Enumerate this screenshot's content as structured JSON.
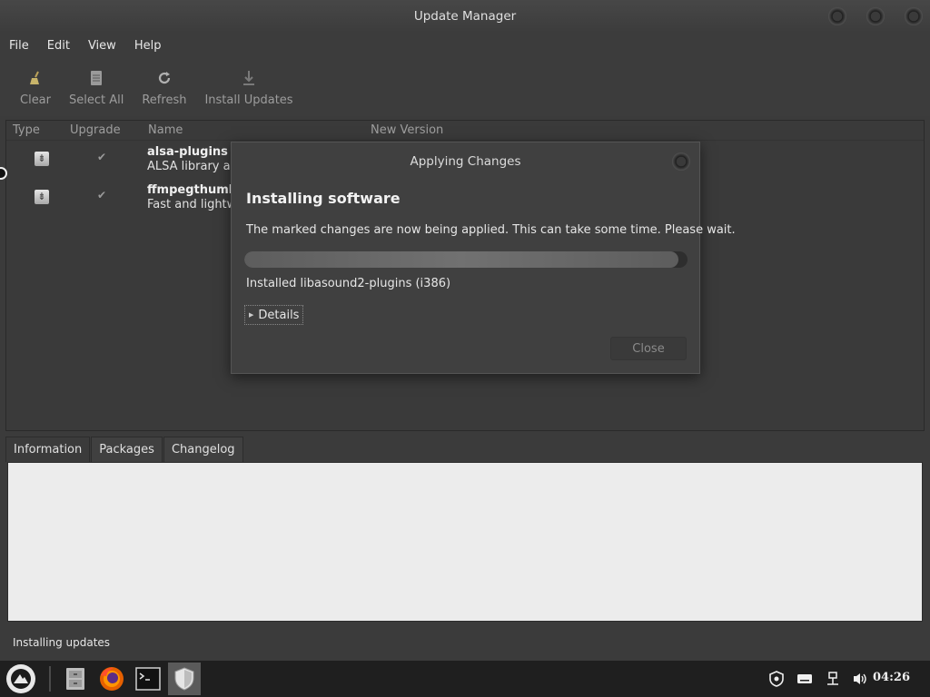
{
  "window": {
    "title": "Update Manager"
  },
  "menu": [
    "File",
    "Edit",
    "View",
    "Help"
  ],
  "toolbar": [
    {
      "label": "Clear",
      "icon": "broom-icon"
    },
    {
      "label": "Select All",
      "icon": "document-icon"
    },
    {
      "label": "Refresh",
      "icon": "refresh-icon"
    },
    {
      "label": "Install Updates",
      "icon": "download-icon"
    }
  ],
  "list": {
    "columns": [
      "Type",
      "Upgrade",
      "Name",
      "New Version"
    ],
    "rows": [
      {
        "name": "alsa-plugins",
        "desc": "ALSA library add",
        "checked": true
      },
      {
        "name": "ffmpegthumbn",
        "desc": "Fast and lightw",
        "checked": true
      }
    ]
  },
  "tabs": [
    "Information",
    "Packages",
    "Changelog"
  ],
  "status": "Installing updates",
  "dialog": {
    "title": "Applying Changes",
    "heading": "Installing software",
    "message": "The marked changes are now being applied. This can take some time. Please wait.",
    "progress": 0.98,
    "status": "Installed libasound2-plugins (i386)",
    "details_label": "Details",
    "close_label": "Close"
  },
  "taskbar": {
    "time": "04:26"
  },
  "colors": {
    "dialog_bg": "#404040",
    "info_bg": "#ececec",
    "taskbar_bg": "#1f1f1f"
  }
}
